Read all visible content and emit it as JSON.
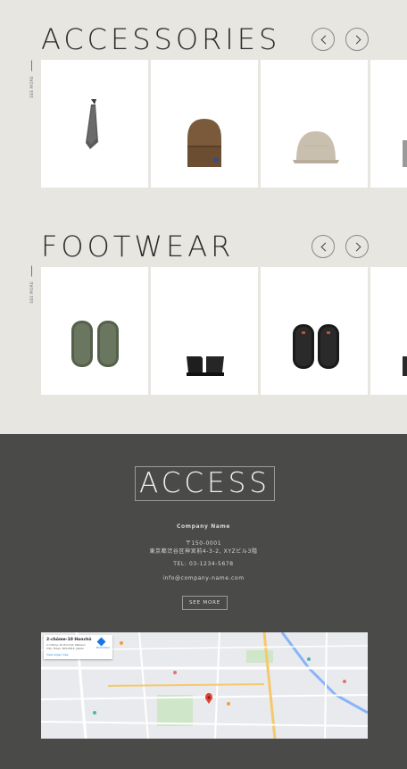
{
  "accessories": {
    "title": "ACCESSORIES",
    "side_label": "SEE MORE",
    "items": [
      "tie",
      "beanie",
      "cap",
      "partial"
    ]
  },
  "footwear": {
    "title": "FOOTWEAR",
    "side_label": "SEE MORE",
    "items": [
      "slippers-olive",
      "boots-black",
      "slippers-black",
      "partial"
    ]
  },
  "access": {
    "title": "ACCESS",
    "company": "Company Name",
    "postal": "〒150-0001",
    "address": "東京都渋谷区神宮前4-3-2, XYZビル3階",
    "tel": "TEL: 03-1234-5678",
    "email": "info@company-name.com",
    "see_more": "SEE MORE"
  },
  "map": {
    "place_title": "2-chōme-10 Honchō",
    "place_address": "2-chōme-10 Honchō, Nakano City, Tokyo 164-0012, Japan",
    "view_larger": "View larger map",
    "directions": "Directions"
  },
  "colors": {
    "top_bg": "#e7e6e1",
    "bottom_bg": "#4a4a48",
    "accent_red": "#e04334"
  }
}
